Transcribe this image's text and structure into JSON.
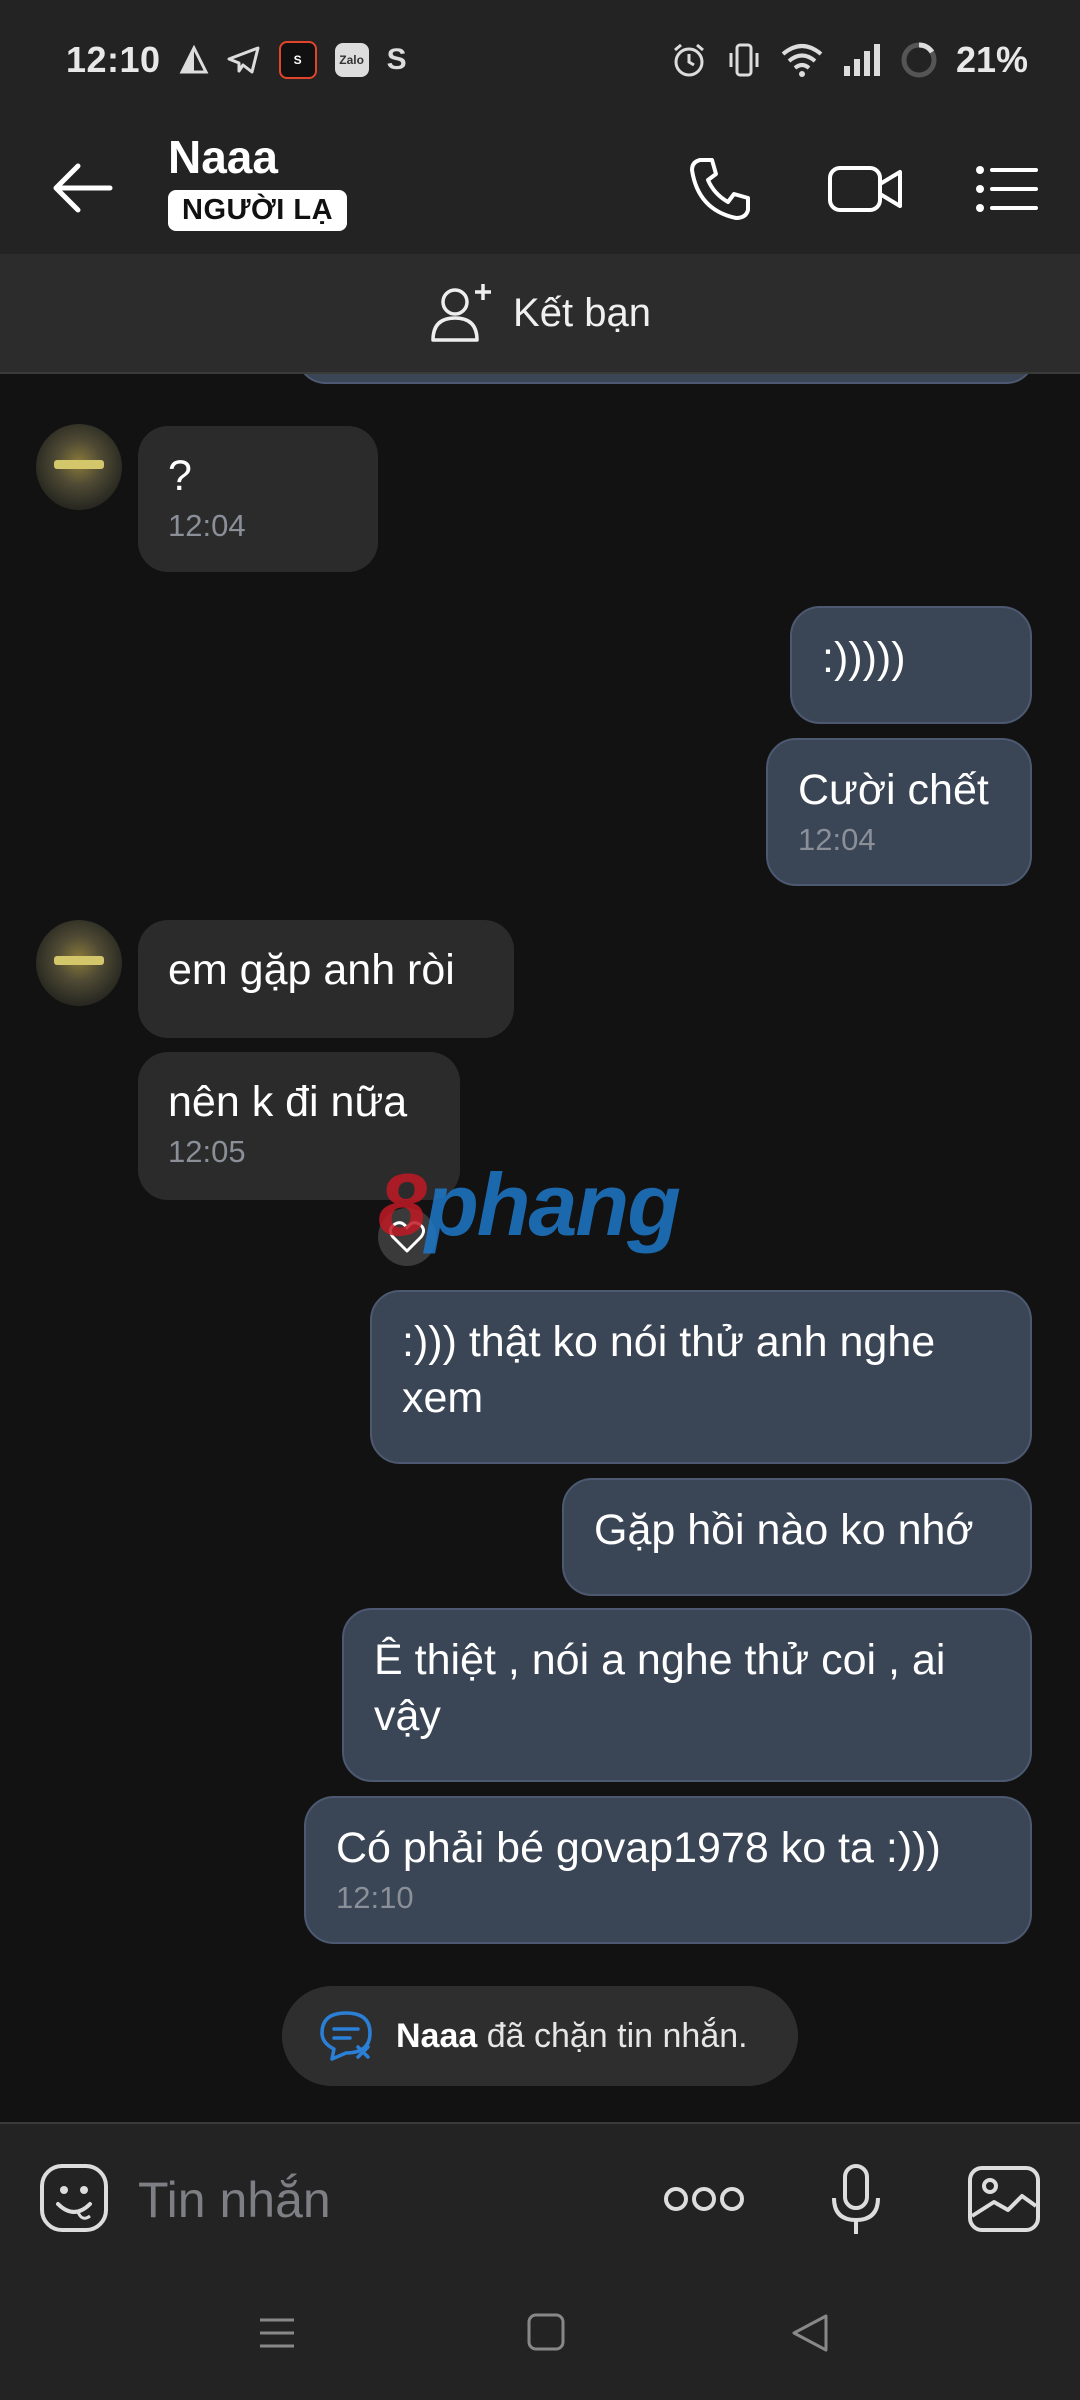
{
  "status_bar": {
    "time": "12:10",
    "battery": "21%",
    "app_icons": [
      "S",
      "Zalo",
      "S"
    ]
  },
  "header": {
    "name": "Naaa",
    "badge": "NGƯỜI LẠ"
  },
  "add_friend": {
    "label": "Kết bạn"
  },
  "messages": [
    {
      "side": "received",
      "text": "?",
      "time": "12:04"
    },
    {
      "side": "sent",
      "text": ":)))))"
    },
    {
      "side": "sent",
      "text": "Cười chết",
      "time": "12:04"
    },
    {
      "side": "received",
      "text": "em gặp anh ròi"
    },
    {
      "side": "received",
      "text": "nên k đi nữa",
      "time": "12:05"
    },
    {
      "side": "sent",
      "text": ":))) thật ko nói thử anh nghe xem"
    },
    {
      "side": "sent",
      "text": "Gặp hồi nào ko nhớ"
    },
    {
      "side": "sent",
      "text": "Ê thiệt , nói a nghe thử coi , ai vậy"
    },
    {
      "side": "sent",
      "text": "Có phải bé govap1978 ko ta :)))",
      "time": "12:10"
    }
  ],
  "watermark": {
    "part1": "8",
    "part2": "phang"
  },
  "blocked_notice": {
    "name": "Naaa",
    "text": " đã chặn tin nhắn."
  },
  "input": {
    "placeholder": "Tin nhắn"
  },
  "colors": {
    "sent_bubble": "#3a4556",
    "received_bubble": "#2b2b2b",
    "background": "#121212",
    "accent": "#1d78c9"
  }
}
